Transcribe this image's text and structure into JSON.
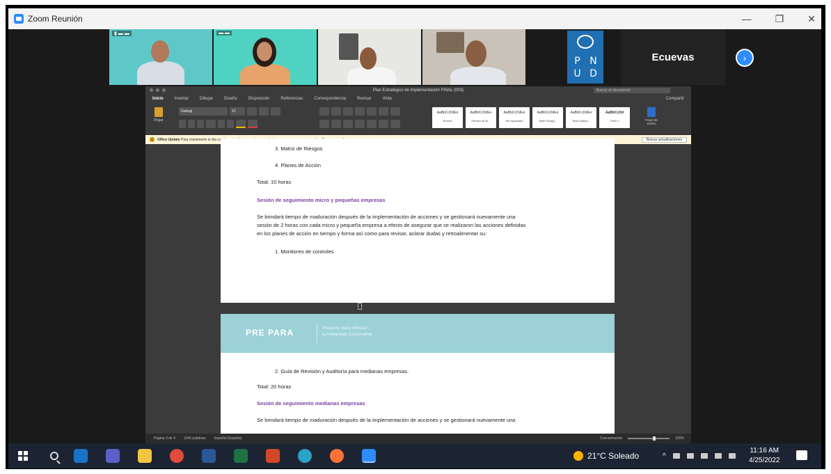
{
  "zoom": {
    "window_title": "Zoom Reunión",
    "window_controls": {
      "minimize": "—",
      "restore": "❐",
      "close": "✕"
    }
  },
  "participants": {
    "next_label": "›",
    "undp_letters": [
      "P",
      "N",
      "U",
      "D"
    ],
    "text_tile_name": "Ecuevas"
  },
  "word": {
    "doc_title": "Plan Estratégico de Implementación FINAL (003)",
    "search_placeholder": "Buscar en documento",
    "tabs": [
      "Inicio",
      "Insertar",
      "Dibujar",
      "Diseño",
      "Disposición",
      "Referencias",
      "Correspondencia",
      "Revisar",
      "Vista"
    ],
    "share_label": "Compartir",
    "paste_label": "Pegar",
    "font_name": "Gadugi",
    "font_size": "12",
    "styles": [
      {
        "sample": "AaBbCcDdEe",
        "name": "Normal"
      },
      {
        "sample": "AaBbCcDdEe",
        "name": "Párrafo de lis..."
      },
      {
        "sample": "AaBbCcDdEe",
        "name": "Sin espaciado"
      },
      {
        "sample": "AaBbCcDdEe",
        "name": "Table Paragr..."
      },
      {
        "sample": "AaBbCcDdEe",
        "name": "Texto indepe..."
      },
      {
        "sample": "AaBbCcDd",
        "name": "Título 1"
      }
    ],
    "styles_panel_label": "Panel de estilos",
    "update_bar": {
      "title": "Office Update",
      "message": "Para mantenerte al día con las actualizaciones de seguridad, correcciones y mejoras, elige Buscar actualizaciones.",
      "button": "Buscar actualizaciones"
    },
    "page1": {
      "item3": "3.   Matriz de Riesgos",
      "item4": "4.   Planes de Acción",
      "total": "Total: 10 horas",
      "heading": "Sesión de seguimiento micro y pequeñas empresas",
      "para_line1": "Se brindará tiempo de maduración después de la implementación de acciones y se gestionará nuevamente una",
      "para_line2": "sesión de 2 horas con cada micro y pequeña empresa a efecto de asegurar que se realizaron las acciones definidas",
      "para_line3": "en los planes de acción en tiempo y forma así como para revisar, aclarar dudas y retroalimentar su:",
      "item1": "1.   Monitoreo de controles"
    },
    "page2": {
      "brand": "PRE PARA",
      "tagline_1": "Proyecto para reforzar",
      "tagline_2": "la Integridad Corporativa",
      "item2": "2.   Guía de Revisión y Auditoría para medianas empresas.",
      "total": "Total: 20 horas",
      "heading": "Sesión de seguimiento medianas empresas",
      "para_line1": "Se brindará tiempo de maduración después de la implementación de acciones y se gestionará nuevamente una"
    },
    "status": {
      "page": "Página 3 de 4",
      "words": "1345 palabras",
      "language": "Español (España)",
      "focus": "Concentración",
      "zoom": "150%"
    }
  },
  "taskbar": {
    "weather": "21°C  Soleado",
    "time": "11:16 AM",
    "date": "4/25/2022",
    "app_icons": [
      {
        "name": "outlook-icon",
        "color": "#1a73c8"
      },
      {
        "name": "teams-icon",
        "color": "#5b5fc7"
      },
      {
        "name": "explorer-icon",
        "color": "#f4c542"
      },
      {
        "name": "chrome-icon",
        "color": "#e24c3b"
      },
      {
        "name": "word-icon",
        "color": "#2b5797"
      },
      {
        "name": "excel-icon",
        "color": "#1f7244"
      },
      {
        "name": "powerpoint-icon",
        "color": "#d24726"
      },
      {
        "name": "edge-icon",
        "color": "#2aa3c6"
      },
      {
        "name": "firefox-icon",
        "color": "#ff7139"
      }
    ]
  }
}
